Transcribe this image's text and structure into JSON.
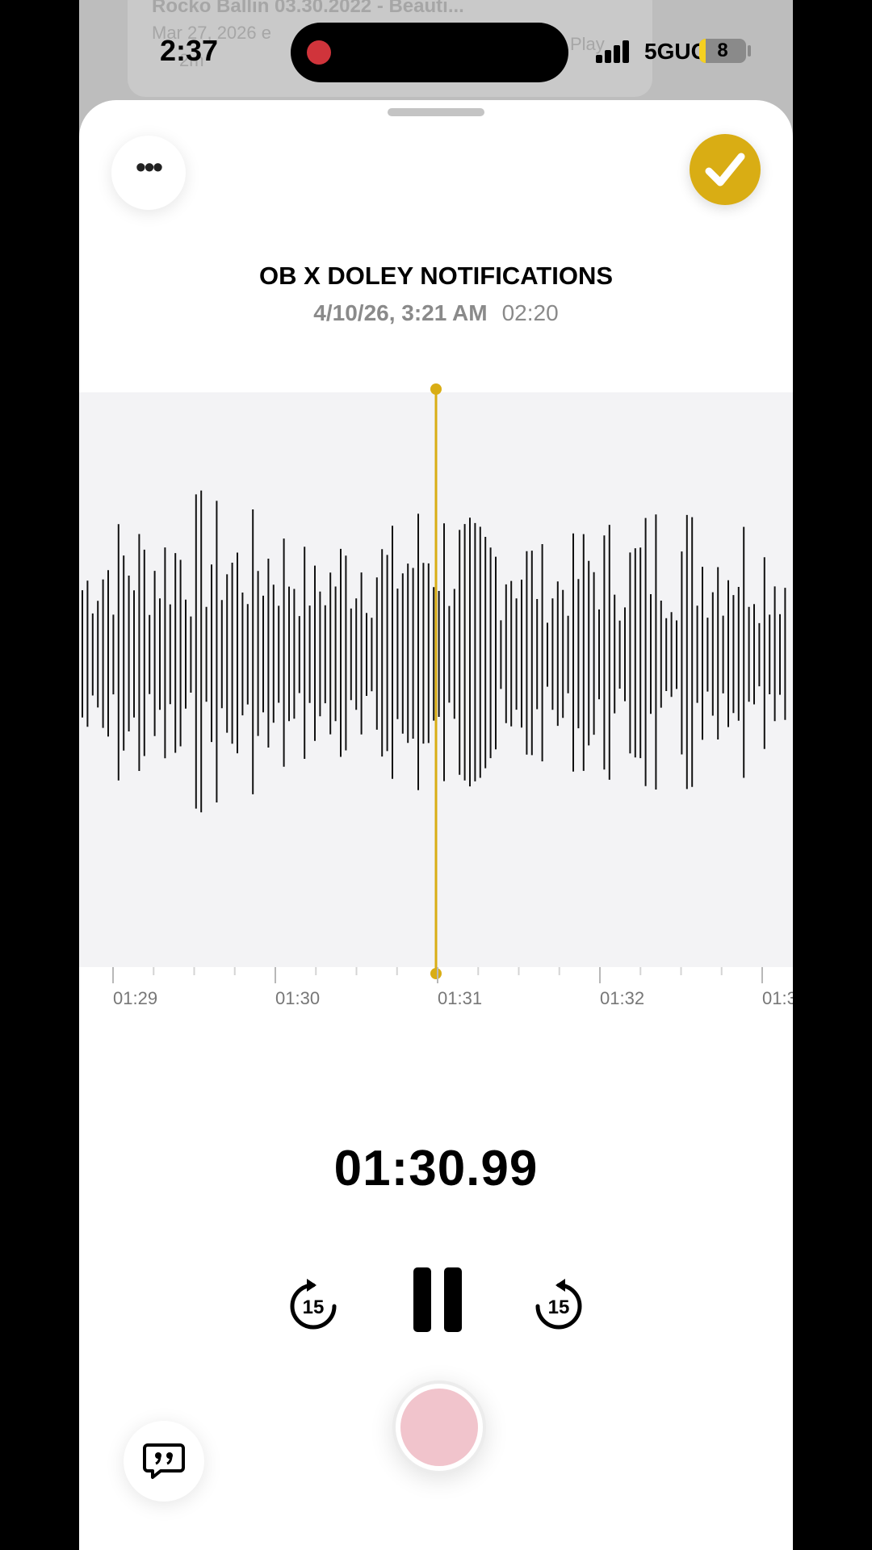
{
  "background_item": {
    "title": "Rocko Ballin 03.30.2022 - Beauti...",
    "subtitle": "Mar 27, 2026 e",
    "play_label": "Play",
    "duration_fragment": "2m"
  },
  "status_bar": {
    "time": "2:37",
    "network": "5GUC",
    "battery": "8"
  },
  "recording": {
    "title": "OB X DOLEY NOTIFICATIONS",
    "date": "4/10/26, 3:21 AM",
    "duration": "02:20",
    "current_time": "01:30.99"
  },
  "timeline": {
    "labels": [
      "01:29",
      "01:30",
      "01:31",
      "01:32",
      "01:3"
    ]
  },
  "controls": {
    "skip_back": "15",
    "skip_forward": "15"
  },
  "colors": {
    "accent": "#d9ad14",
    "record": "#f1c4cc",
    "waveform": "#111111"
  }
}
